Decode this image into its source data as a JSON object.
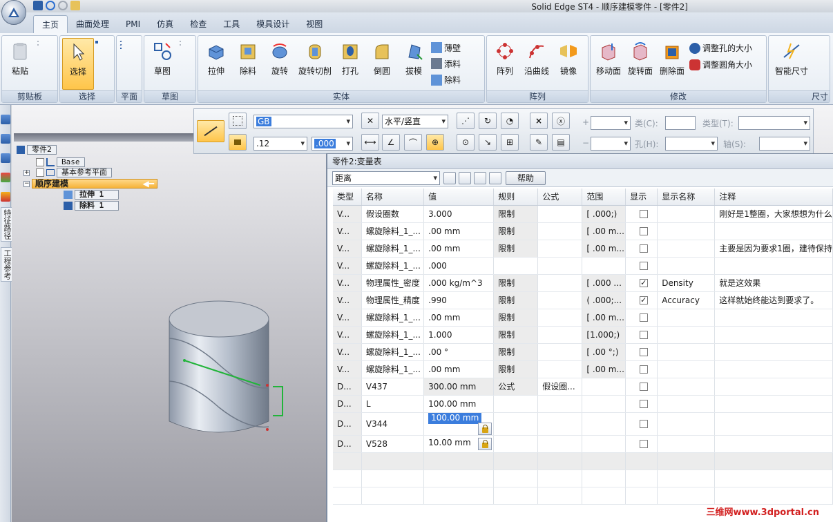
{
  "window": {
    "title": "Solid Edge ST4 - 顺序建模零件 - [零件2]"
  },
  "ribbon_tabs": [
    "主页",
    "曲面处理",
    "PMI",
    "仿真",
    "检查",
    "工具",
    "模具设计",
    "视图"
  ],
  "ribbon": {
    "clipboard": {
      "label": "剪贴板",
      "paste": "粘贴"
    },
    "select": {
      "label": "选择",
      "select": "选择"
    },
    "plane": {
      "label": "平面"
    },
    "sketch": {
      "label": "草图",
      "sketch": "草图"
    },
    "solid": {
      "label": "实体",
      "extrude": "拉伸",
      "cut": "除料",
      "revolve": "旋转",
      "revolve_cut": "旋转切削",
      "hole": "打孔",
      "round": "倒圆",
      "draft": "拔模",
      "thin_wall": "薄壁",
      "add": "添料",
      "remove": "除料"
    },
    "pattern": {
      "label": "阵列",
      "pattern": "阵列",
      "along_curve": "沿曲线",
      "mirror": "镜像"
    },
    "modify": {
      "label": "修改",
      "move_face": "移动面",
      "rotate_face": "旋转面",
      "delete_face": "删除面",
      "resize_hole": "调整孔的大小",
      "resize_round": "调整圆角大小"
    },
    "dimension": {
      "label": "尺寸",
      "smart_dim": "智能尺寸"
    }
  },
  "tree": {
    "root": "零件2",
    "base": "Base",
    "ref_planes": "基本参考平面",
    "ordered": "顺序建模",
    "extrude": "拉伸 1",
    "cut": "除料 1"
  },
  "left_labels": {
    "feature_pathfinder": "特征路径",
    "ref": "工程参考"
  },
  "command_bar": {
    "standard": "GB",
    "precision": ".12",
    "orientation": "水平/竖直",
    "value_field": ".000",
    "class_label": "类(C):",
    "type_label": "类型(T):",
    "hole_label": "孔(H):",
    "axis_label": "轴(S):",
    "plus": "+",
    "minus": "−"
  },
  "var_table": {
    "title": "零件2:变量表",
    "filter": "距离",
    "help": "帮助",
    "columns": [
      "类型",
      "名称",
      "值",
      "规则",
      "公式",
      "范围",
      "显示",
      "显示名称",
      "注释"
    ],
    "rows": [
      {
        "type": "V...",
        "name": "假设圈数",
        "value": "3.000",
        "rule": "限制",
        "formula": "",
        "range": "[ .000;)",
        "show": false,
        "display_name": "",
        "note": "刚好是1整圈，大家想想为什么",
        "lock": false,
        "selected": false
      },
      {
        "type": "V...",
        "name": "螺旋除料_1_...",
        "value": ".00 mm",
        "rule": "限制",
        "formula": "",
        "range": "[ .00 m...",
        "show": false,
        "display_name": "",
        "note": "",
        "lock": false,
        "selected": false
      },
      {
        "type": "V...",
        "name": "螺旋除料_1_...",
        "value": ".00 mm",
        "rule": "限制",
        "formula": "",
        "range": "[ .00 m...",
        "show": false,
        "display_name": "",
        "note": "主要是因为要求1圈，建待保持",
        "lock": false,
        "selected": false
      },
      {
        "type": "V...",
        "name": "螺旋除料_1_...",
        "value": ".000",
        "rule": "",
        "formula": "",
        "range": "",
        "show": false,
        "display_name": "",
        "note": "",
        "lock": false,
        "selected": false
      },
      {
        "type": "V...",
        "name": "物理属性_密度",
        "value": ".000 kg/m^3",
        "rule": "限制",
        "formula": "",
        "range": "[ .000 ...",
        "show": true,
        "display_name": "Density",
        "note": "就是这效果",
        "lock": false,
        "selected": false
      },
      {
        "type": "V...",
        "name": "物理属性_精度",
        "value": ".990",
        "rule": "限制",
        "formula": "",
        "range": "( .000;...",
        "show": true,
        "display_name": "Accuracy",
        "note": "这样就始终能达到要求了。",
        "lock": false,
        "selected": false
      },
      {
        "type": "V...",
        "name": "螺旋除料_1_...",
        "value": ".00 mm",
        "rule": "限制",
        "formula": "",
        "range": "[ .00 m...",
        "show": false,
        "display_name": "",
        "note": "",
        "lock": false,
        "selected": false
      },
      {
        "type": "V...",
        "name": "螺旋除料_1_...",
        "value": "1.000",
        "rule": "限制",
        "formula": "",
        "range": "[1.000;)",
        "show": false,
        "display_name": "",
        "note": "",
        "lock": false,
        "selected": false
      },
      {
        "type": "V...",
        "name": "螺旋除料_1_...",
        "value": ".00 °",
        "rule": "限制",
        "formula": "",
        "range": "[ .00 °;)",
        "show": false,
        "display_name": "",
        "note": "",
        "lock": false,
        "selected": false
      },
      {
        "type": "V...",
        "name": "螺旋除料_1_...",
        "value": ".00 mm",
        "rule": "限制",
        "formula": "",
        "range": "[ .00 m...",
        "show": false,
        "display_name": "",
        "note": "",
        "lock": false,
        "selected": false
      },
      {
        "type": "D...",
        "name": "V437",
        "value": "300.00 mm",
        "rule": "公式",
        "formula": "假设圈...",
        "range": "",
        "show": false,
        "display_name": "",
        "note": "",
        "lock": false,
        "selected": false
      },
      {
        "type": "D...",
        "name": "L",
        "value": "100.00 mm",
        "rule": "",
        "formula": "",
        "range": "",
        "show": false,
        "display_name": "",
        "note": "",
        "lock": false,
        "selected": false
      },
      {
        "type": "D...",
        "name": "V344",
        "value": "100.00 mm",
        "rule": "",
        "formula": "",
        "range": "",
        "show": false,
        "display_name": "",
        "note": "",
        "lock": true,
        "selected": true
      },
      {
        "type": "D...",
        "name": "V528",
        "value": "10.00 mm",
        "rule": "",
        "formula": "",
        "range": "",
        "show": false,
        "display_name": "",
        "note": "",
        "lock": true,
        "selected": false
      }
    ]
  },
  "watermark": "三维网www.3dportal.cn",
  "colors": {
    "accent": "#f6b33a",
    "selection": "#3b7ddd",
    "dimension": "#22b43a"
  }
}
